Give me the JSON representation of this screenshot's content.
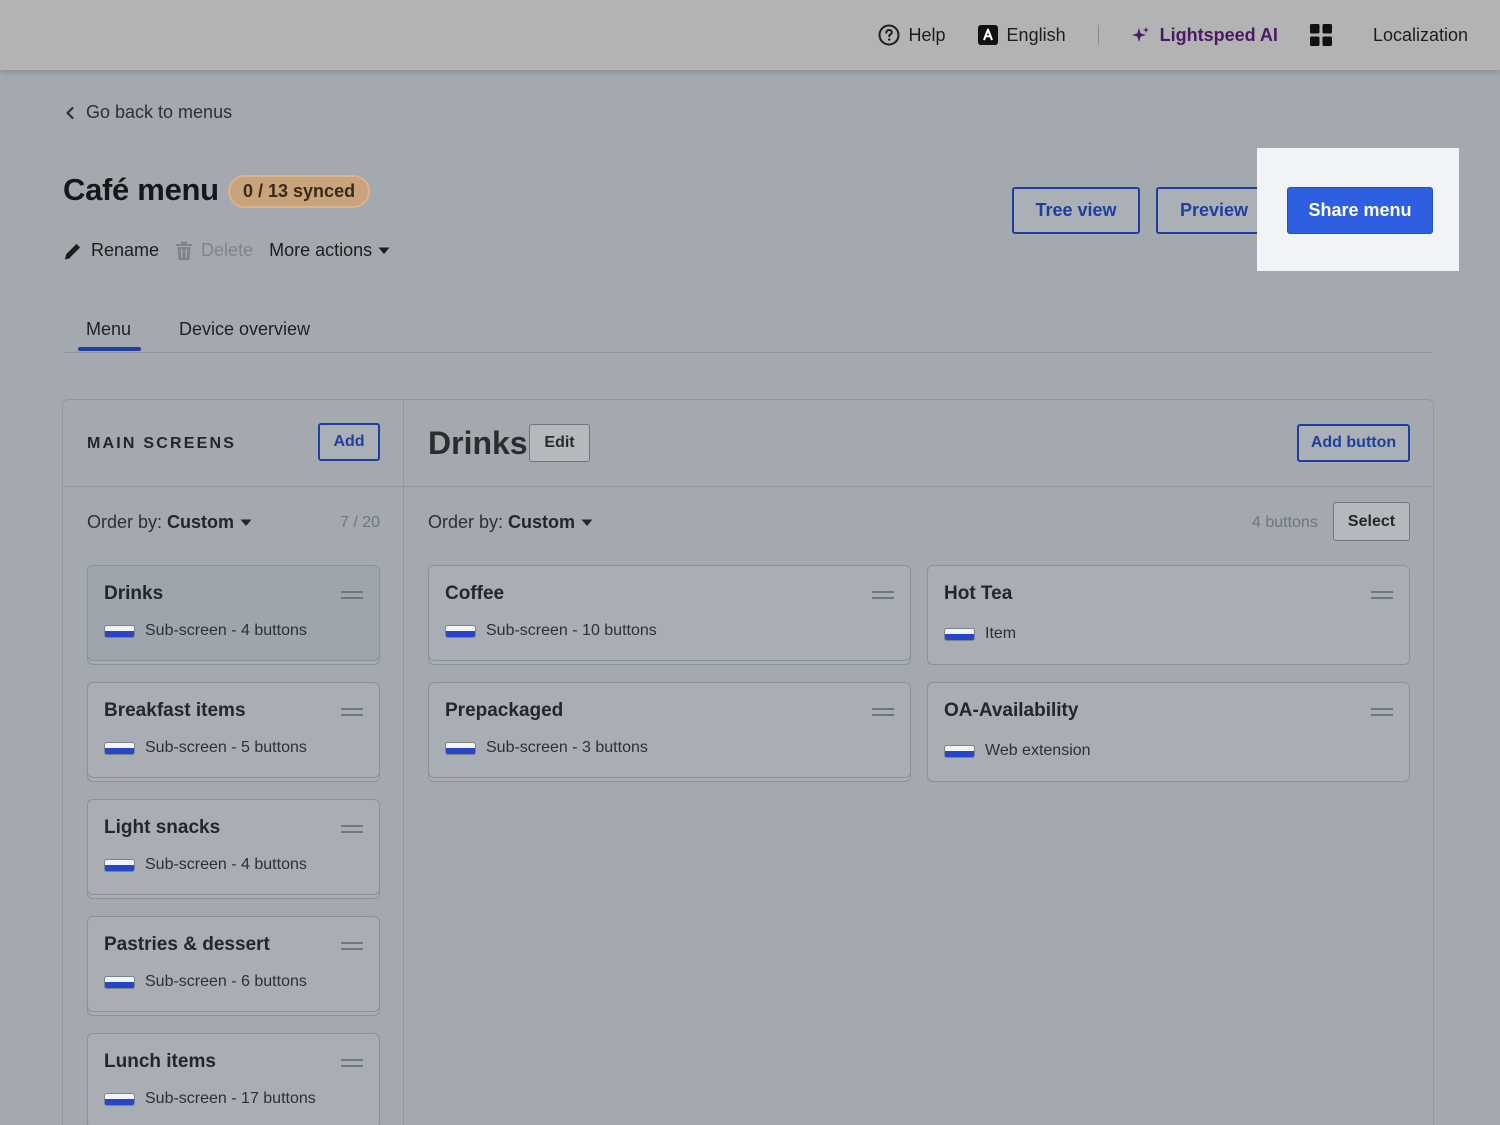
{
  "topbar": {
    "help": "Help",
    "language": "English",
    "ai": "Lightspeed AI",
    "localization": "Localization"
  },
  "back_label": "Go back to menus",
  "menu": {
    "title": "Café menu",
    "sync_status": "0 / 13 synced",
    "rename": "Rename",
    "delete": "Delete",
    "more_actions": "More actions"
  },
  "header_buttons": {
    "tree_view": "Tree view",
    "preview": "Preview",
    "share_menu": "Share menu"
  },
  "tabs": [
    {
      "label": "Menu",
      "active": true
    },
    {
      "label": "Device overview",
      "active": false
    }
  ],
  "main_screens": {
    "heading": "MAIN SCREENS",
    "add": "Add",
    "order_label": "Order by:",
    "order_value": "Custom",
    "count": "7 / 20",
    "items": [
      {
        "title": "Drinks",
        "subtitle": "Sub-screen - 4 buttons"
      },
      {
        "title": "Breakfast items",
        "subtitle": "Sub-screen - 5 buttons"
      },
      {
        "title": "Light snacks",
        "subtitle": "Sub-screen - 4 buttons"
      },
      {
        "title": "Pastries & dessert",
        "subtitle": "Sub-screen - 6 buttons"
      },
      {
        "title": "Lunch items",
        "subtitle": "Sub-screen - 17 buttons"
      }
    ]
  },
  "screen": {
    "title": "Drinks",
    "edit": "Edit",
    "add_button": "Add button",
    "order_label": "Order by:",
    "order_value": "Custom",
    "count": "4 buttons",
    "select": "Select",
    "buttons": [
      {
        "title": "Coffee",
        "subtitle": "Sub-screen - 10 buttons"
      },
      {
        "title": "Hot Tea",
        "subtitle": "Item"
      },
      {
        "title": "Prepackaged",
        "subtitle": "Sub-screen - 3 buttons"
      },
      {
        "title": "OA-Availability",
        "subtitle": "Web extension"
      }
    ]
  },
  "colors": {
    "accent": "#1e3fa0",
    "primary": "#2e5fe0",
    "ai": "#4a1a66",
    "badge": "#c9a37c"
  }
}
